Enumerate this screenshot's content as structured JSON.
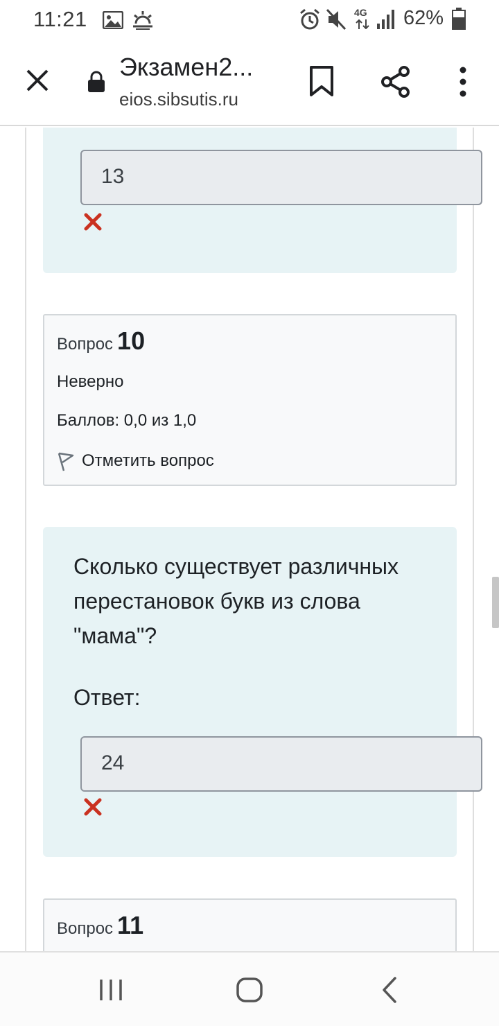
{
  "status_bar": {
    "time": "11:21",
    "battery_percent": "62%",
    "network": "4G",
    "icons": [
      "gallery-icon",
      "weather-icon",
      "alarm-icon",
      "mute-icon",
      "network-4g-icon",
      "signal-icon",
      "battery-icon"
    ]
  },
  "browser": {
    "title": "Экзамен2...",
    "url": "eios.sibsutis.ru",
    "icons": [
      "close-icon",
      "lock-icon",
      "bookmark-icon",
      "share-icon",
      "more-icon"
    ]
  },
  "prev_question": {
    "answer_value": "13",
    "result_icon": "incorrect-x-icon"
  },
  "question_10": {
    "label": "Вопрос",
    "number": "10",
    "state": "Неверно",
    "grade": "Баллов: 0,0 из 1,0",
    "flag_label": "Отметить вопрос",
    "text": "Сколько существует различных перестановок букв из слова \"мама\"?",
    "prompt": "Ответ:",
    "answer_value": "24",
    "result_icon": "incorrect-x-icon"
  },
  "question_11": {
    "label": "Вопрос",
    "number": "11"
  },
  "colors": {
    "qtext_background": "#e7f3f5",
    "info_background": "#f8f9fa",
    "incorrect_red": "#ca3120"
  }
}
